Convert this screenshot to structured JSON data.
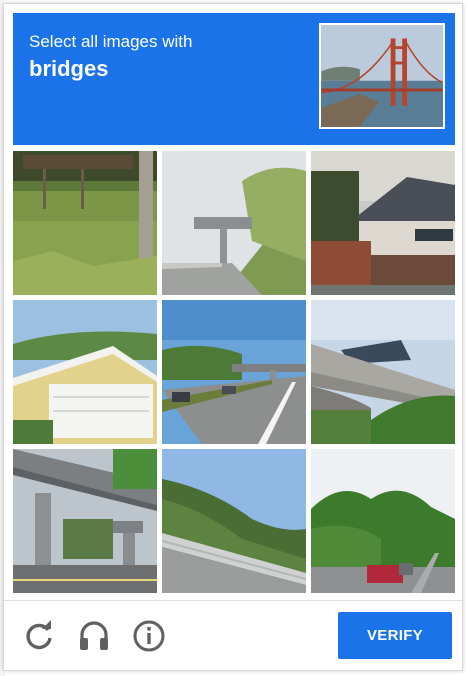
{
  "header": {
    "prompt_line1": "Select all images with",
    "prompt_target": "bridges"
  },
  "example_image": {
    "icon": "golden-gate-bridge-example"
  },
  "grid": {
    "rows": 3,
    "columns": 3,
    "tiles": [
      {
        "scene": "grass-field-with-pole",
        "selected": false
      },
      {
        "scene": "highway-overpass",
        "selected": false
      },
      {
        "scene": "house-with-gray-roof",
        "selected": false
      },
      {
        "scene": "yellow-house-garage",
        "selected": false
      },
      {
        "scene": "highway-with-overpass",
        "selected": false
      },
      {
        "scene": "concrete-bridge-underside",
        "selected": false
      },
      {
        "scene": "elevated-highway",
        "selected": false
      },
      {
        "scene": "wooded-hillside-railing",
        "selected": false
      },
      {
        "scene": "residential-street-trees",
        "selected": false
      }
    ]
  },
  "footer": {
    "reload_icon": "reload-icon",
    "audio_icon": "headphones-icon",
    "info_icon": "info-icon",
    "verify_label": "VERIFY"
  },
  "colors": {
    "accent": "#1a73e8",
    "icon_gray": "#606060"
  }
}
